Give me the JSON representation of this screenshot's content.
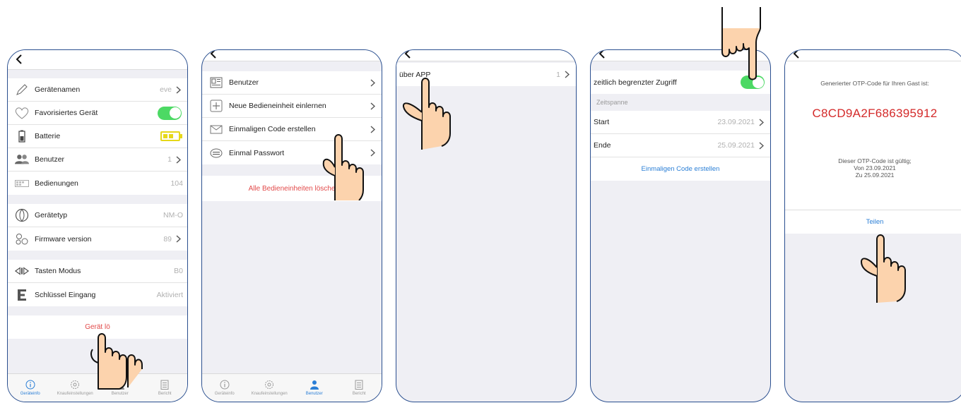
{
  "screen1": {
    "rows_a": [
      {
        "label": "Gerätenamen",
        "value": "eve",
        "chevron": true,
        "icon": "pencil-icon"
      },
      {
        "label": "Favorisiertes Gerät",
        "value": "",
        "toggle": true,
        "icon": "heart-icon"
      },
      {
        "label": "Batterie",
        "value": "",
        "battery": true,
        "icon": "battery-icon"
      },
      {
        "label": "Benutzer",
        "value": "1",
        "chevron": true,
        "icon": "users-icon"
      },
      {
        "label": "Bedienungen",
        "value": "104",
        "chevron": false,
        "icon": "keypad-icon"
      }
    ],
    "rows_b": [
      {
        "label": "Gerätetyp",
        "value": "NM-O",
        "chevron": false,
        "icon": "device-type-icon"
      },
      {
        "label": "Firmware version",
        "value": "89",
        "chevron": true,
        "icon": "gears-icon"
      }
    ],
    "rows_c": [
      {
        "label": "Tasten Modus",
        "value": "B0",
        "chevron": false,
        "icon": "arrows-icon"
      },
      {
        "label": "Schlüssel Eingang",
        "value": "Aktiviert",
        "chevron": false,
        "icon": "letter-e-icon"
      }
    ],
    "delete_label": "Gerät lö"
  },
  "screen2": {
    "rows": [
      {
        "label": "Benutzer",
        "icon": "user-card-icon"
      },
      {
        "label": "Neue Bedieneinheit einlernen",
        "icon": "plus-box-icon"
      },
      {
        "label": "Einmaligen Code erstellen",
        "icon": "envelope-icon"
      },
      {
        "label": "Einmal Passwort",
        "icon": "keyboard-icon"
      }
    ],
    "delete_all_label": "Alle Bedieneinheiten lösche"
  },
  "screen3": {
    "row": {
      "label": "über APP",
      "value": "1"
    }
  },
  "screen4": {
    "access_label": "zeitlich begrenzter Zugriff",
    "section_header": "Zeitspanne",
    "start_label": "Start",
    "start_value": "23.09.2021",
    "end_label": "Ende",
    "end_value": "25.09.2021",
    "create_label": "Einmaligen Code erstellen"
  },
  "screen5": {
    "title": "Generierter OTP-Code für Ihren Gast ist:",
    "code": "C8CD9A2F686395912",
    "valid_line1": "Dieser OTP-Code ist gültig;",
    "valid_line2": "Von 23.09.2021",
    "valid_line3": "Zu 25.09.2021",
    "share_label": "Teilen"
  },
  "tabs": [
    {
      "label": "Geräteinfo",
      "icon": "info-icon"
    },
    {
      "label": "Knaufeinstellungen",
      "icon": "gear-icon"
    },
    {
      "label": "Benutzer",
      "icon": "person-icon"
    },
    {
      "label": "Bericht",
      "icon": "report-icon"
    }
  ],
  "colors": {
    "accent_blue": "#2b7fd6",
    "toggle_green": "#4cd964",
    "danger_red": "#e24a4a",
    "otp_red": "#d42a2a",
    "frame_blue": "#2a4f8f"
  }
}
